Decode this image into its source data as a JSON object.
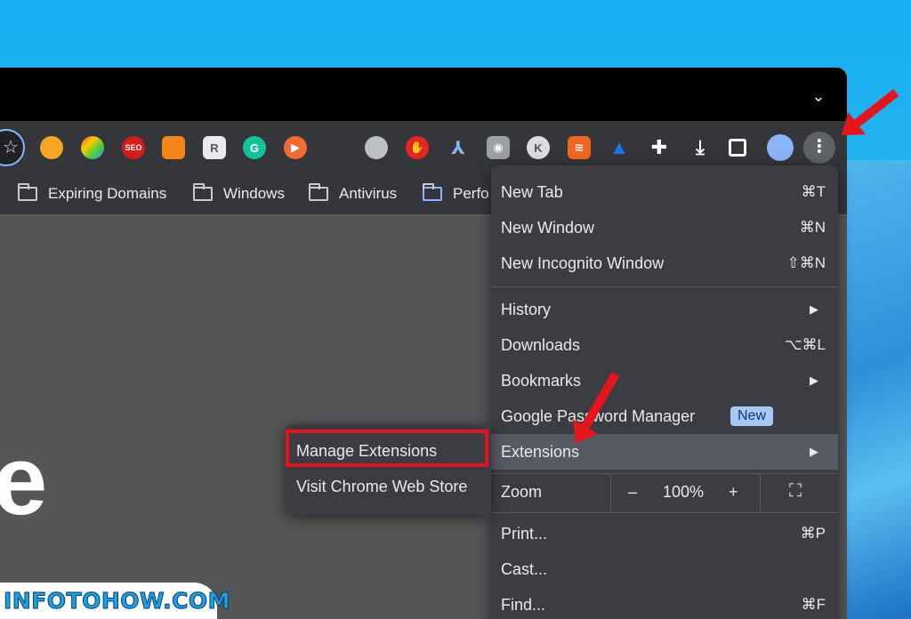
{
  "bookmarks": [
    {
      "label": "Expiring Domains"
    },
    {
      "label": "Windows"
    },
    {
      "label": "Antivirus"
    },
    {
      "label": "Perfo"
    }
  ],
  "menu": {
    "new_tab": {
      "label": "New Tab",
      "shortcut": "⌘T"
    },
    "new_window": {
      "label": "New Window",
      "shortcut": "⌘N"
    },
    "new_incognito": {
      "label": "New Incognito Window",
      "shortcut": "⇧⌘N"
    },
    "history": {
      "label": "History"
    },
    "downloads": {
      "label": "Downloads",
      "shortcut": "⌥⌘L"
    },
    "bookmarks": {
      "label": "Bookmarks"
    },
    "password_manager": {
      "label": "Google Password Manager",
      "badge": "New"
    },
    "extensions": {
      "label": "Extensions"
    },
    "zoom": {
      "label": "Zoom",
      "minus": "–",
      "value": "100%",
      "plus": "+"
    },
    "print": {
      "label": "Print...",
      "shortcut": "⌘P"
    },
    "cast": {
      "label": "Cast..."
    },
    "find": {
      "label": "Find...",
      "shortcut": "⌘F"
    }
  },
  "submenu": {
    "manage": "Manage Extensions",
    "store": "Visit Chrome Web Store"
  },
  "content": {
    "big_letter": "e"
  },
  "watermark": "INFOTOHOW.COM",
  "colors": {
    "highlight": "#e3161e",
    "menu_bg": "#3c3d42",
    "badge_bg": "#a8c7fa"
  }
}
